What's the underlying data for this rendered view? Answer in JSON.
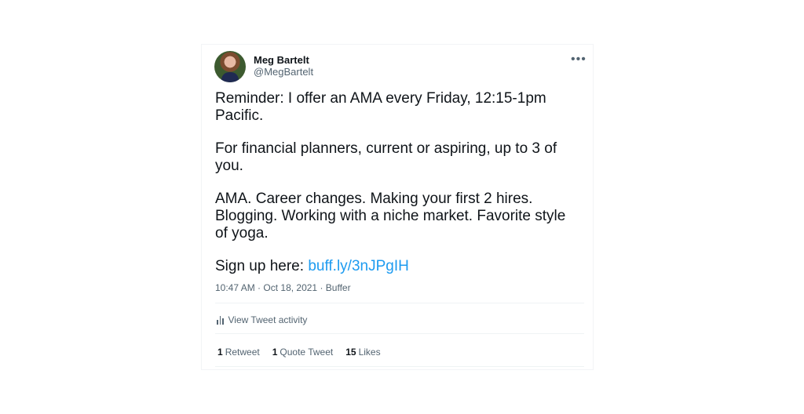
{
  "tweet": {
    "author": {
      "name": "Meg Bartelt",
      "handle": "@MegBartelt"
    },
    "more_icon": "more-dots-icon",
    "paragraphs": [
      "Reminder: I offer an AMA every Friday, 12:15-1pm Pacific.",
      "For financial planners, current or aspiring, up to 3 of you.",
      "AMA. Career changes. Making your first 2 hires. Blogging. Working with a niche market. Favorite style of yoga."
    ],
    "signup_prefix": "Sign up here: ",
    "link_text": "buff.ly/3nJPgIH",
    "time": "10:47 AM",
    "date": "Oct 18, 2021",
    "source": "Buffer",
    "separator": "·",
    "activity_label": "View Tweet activity",
    "activity_icon": "bar-chart-icon",
    "stats": {
      "retweets_count": "1",
      "retweets_label": "Retweet",
      "quotes_count": "1",
      "quotes_label": "Quote Tweet",
      "likes_count": "15",
      "likes_label": "Likes"
    }
  },
  "colors": {
    "link": "#1d9bf0",
    "secondary_text": "#536471",
    "primary_text": "#0f1419"
  }
}
